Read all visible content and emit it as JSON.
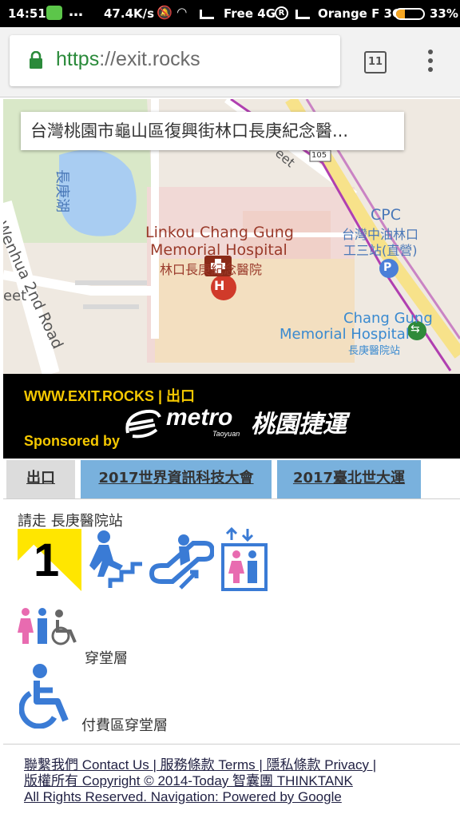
{
  "status_bar": {
    "time": "14:51",
    "speed": "47.4K/s",
    "carrier1": "Free 4G",
    "carrier2": "Orange F 3G",
    "battery": "33%"
  },
  "browser": {
    "url_scheme": "https",
    "url_rest": "://exit.rocks",
    "tab_count": "11"
  },
  "map": {
    "address": "台灣桃園市龜山區復興街林口長庚紀念醫...",
    "labels": {
      "lake": "長庚湖",
      "road": "Wenhua 2nd Road",
      "street_fragment": "eet",
      "street_fragment2": "eet",
      "road_number": "105",
      "hospital_en1": "Linkou Chang Gung",
      "hospital_en2": "Memorial Hospital",
      "hospital_zh": "林口長庚紀念醫院",
      "cpc": "CPC",
      "cpc_zh1": "台灣中油林口",
      "cpc_zh2": "工三站(直營)",
      "station_en1": "Chang Gung",
      "station_en2": "Memorial Hospital",
      "station_zh": "長庚醫院站"
    }
  },
  "banner": {
    "url_text": "WWW.EXIT.ROCKS | 出口",
    "metro_word": "metro",
    "metro_sub": "Taoyuan",
    "metro_cn": "桃園捷運",
    "sponsored": "Sponsored by"
  },
  "tabs": [
    {
      "label": "出口"
    },
    {
      "label": "2017世界資訊科技大會"
    },
    {
      "label": "2017臺北世大運"
    }
  ],
  "content": {
    "walk_text": "請走 長庚醫院站",
    "exit_number": "1",
    "level1": "穿堂層",
    "level2": "付費區穿堂層"
  },
  "footer": {
    "line1": "聯繫我們 Contact Us | 服務條款 Terms | 隱私條款 Privacy |",
    "line2": "版權所有 Copyright © 2014-Today 智囊團 THINKTANK",
    "line3": "All Rights Reserved. Navigation: Powered by Google"
  },
  "colors": {
    "accent_blue": "#3a7bd5",
    "tab_blue": "#79b1dd",
    "exit_yellow": "#ffe600",
    "banner_yellow": "#f5c800"
  }
}
